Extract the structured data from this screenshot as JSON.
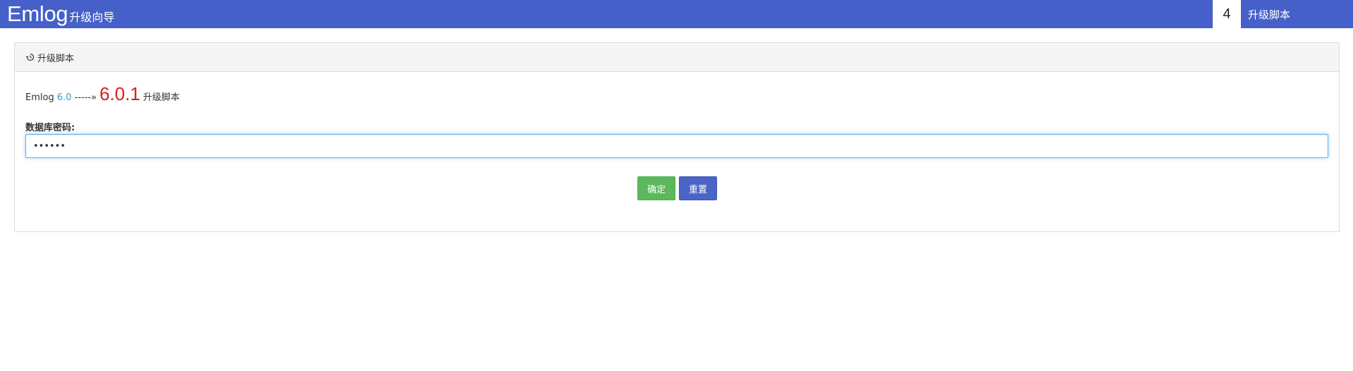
{
  "header": {
    "brand": "Emlog",
    "subtitle": "升级向导",
    "step_number": "4",
    "step_label": "升级脚本"
  },
  "panel": {
    "heading_icon": "history-icon",
    "heading": "升级脚本",
    "version": {
      "product": "Emlog",
      "from_version": "6.0",
      "arrow": "-----»",
      "to_version": "6.0.1",
      "suffix": "升级脚本"
    },
    "password": {
      "label": "数据库密码:",
      "value": "******"
    },
    "buttons": {
      "confirm": "确定",
      "reset": "重置"
    }
  },
  "colors": {
    "topbar": "#4560c9",
    "old_version": "#2aa0c8",
    "new_version": "#d9201f",
    "confirm_button": "#5cb85c",
    "reset_button": "#4a64c8"
  }
}
